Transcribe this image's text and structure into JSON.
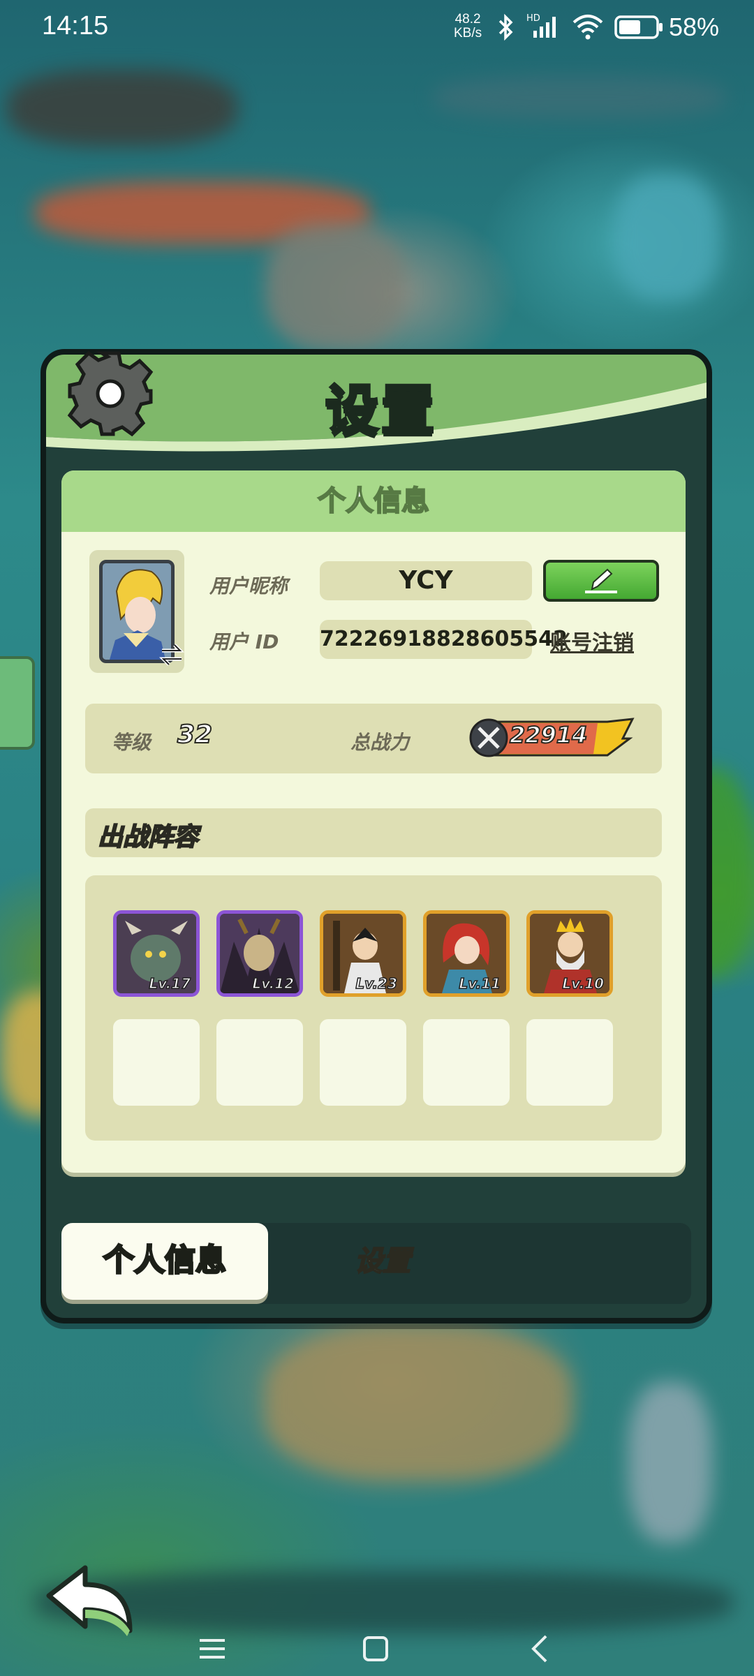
{
  "status_bar": {
    "time": "14:15",
    "net_speed_value": "48.2",
    "net_speed_unit": "KB/s",
    "battery_percent": "58%"
  },
  "dialog": {
    "title": "设置",
    "panel_title": "个人信息",
    "nickname_label": "用户昵称",
    "nickname_value": "YCY",
    "user_id_label": "用户  ID",
    "user_id_value": "72226918828605542",
    "cancel_account": "账号注销",
    "level_label": "等级",
    "level_value": "32",
    "power_label": "总战力",
    "power_value": "22914",
    "lineup_title": "出战阵容",
    "heroes": [
      {
        "level": "Lv.17",
        "frame": "purple"
      },
      {
        "level": "Lv.12",
        "frame": "purple"
      },
      {
        "level": "Lv.23",
        "frame": "orange"
      },
      {
        "level": "Lv.11",
        "frame": "orange"
      },
      {
        "level": "Lv.10",
        "frame": "orange"
      }
    ]
  },
  "tabs": {
    "active": "个人信息",
    "inactive": "设置"
  },
  "colors": {
    "header_green": "#a8d98a",
    "panel_bg": "#f3f8dc",
    "field_bg": "#dedfb4",
    "edit_green": "#44a832",
    "purple_frame": "#8c55d6",
    "orange_frame": "#e0a02a"
  },
  "icons": {
    "gear": "gear-icon",
    "edit": "pencil-icon",
    "back": "back-arrow-icon",
    "power": "crossed-swords-icon"
  }
}
